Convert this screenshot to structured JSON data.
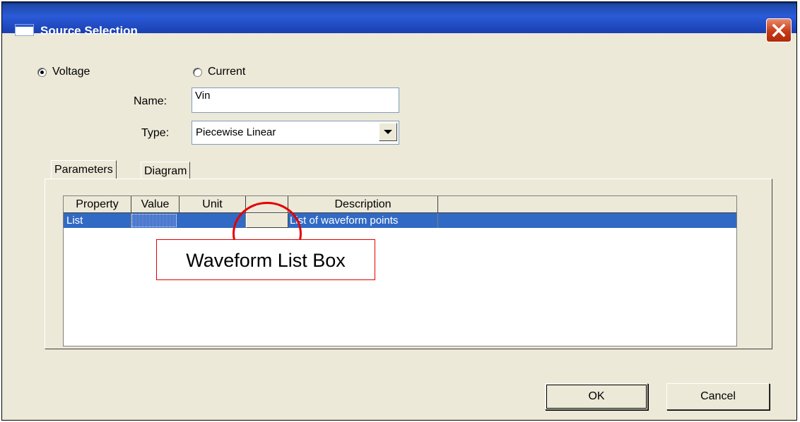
{
  "window": {
    "title": "Source Selection"
  },
  "source": {
    "voltage_label": "Voltage",
    "current_label": "Current",
    "selected": "Voltage"
  },
  "form": {
    "name_label": "Name:",
    "name_value": "Vin",
    "type_label": "Type:",
    "type_value": "Piecewise Linear"
  },
  "tabs": [
    {
      "label": "Parameters",
      "active": true
    },
    {
      "label": "Diagram",
      "active": false
    }
  ],
  "grid": {
    "columns": [
      "Property",
      "Value",
      "Unit",
      "",
      "Description"
    ],
    "rows": [
      {
        "property": "List",
        "value": "",
        "unit": "",
        "button": "",
        "description": "List of waveform points"
      }
    ]
  },
  "annotation": {
    "callout_text": "Waveform List Box"
  },
  "buttons": {
    "ok": "OK",
    "cancel": "Cancel"
  },
  "colors": {
    "titlebar": "#2a5bd8",
    "selection": "#316ac5",
    "annotation": "#e30000",
    "dialog_bg": "#ece9d8"
  }
}
